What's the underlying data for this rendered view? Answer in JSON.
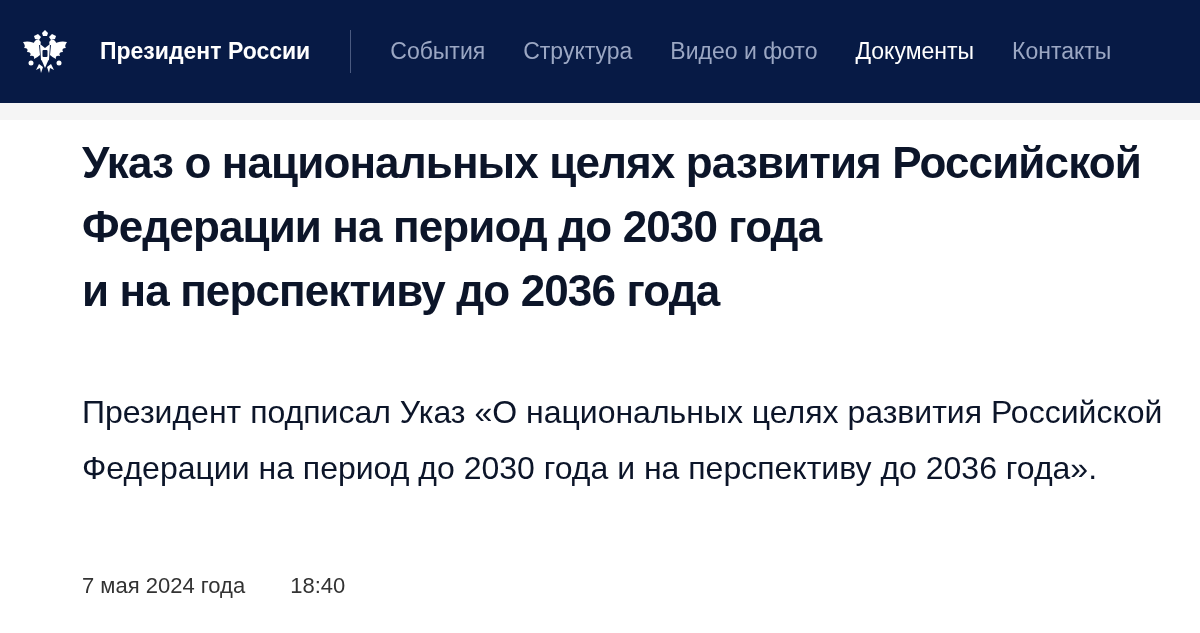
{
  "header": {
    "site_title": "Президент России",
    "nav": [
      {
        "label": "События",
        "selected": false
      },
      {
        "label": "Структура",
        "selected": false
      },
      {
        "label": "Видео и фото",
        "selected": false
      },
      {
        "label": "Документы",
        "selected": true
      },
      {
        "label": "Контакты",
        "selected": false
      }
    ]
  },
  "article": {
    "title": "Указ о национальных целях развития Российской\nФедерации на период до 2030 года\nи на перспективу до 2036 года",
    "lead": "Президент подписал Указ «О национальных целях развития Российской Федерации на период до 2030 года и на перспективу до 2036 года».",
    "date": "7 мая 2024 года",
    "time": "18:40"
  }
}
